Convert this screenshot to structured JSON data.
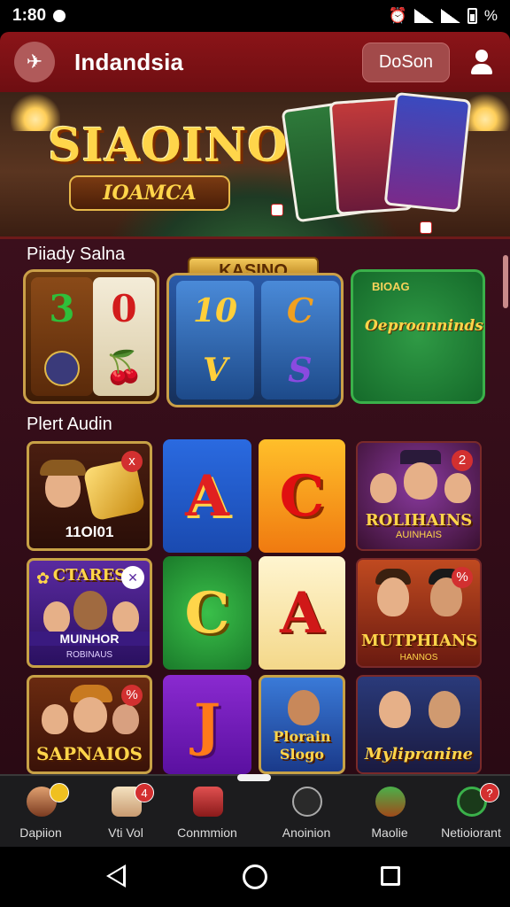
{
  "status_bar": {
    "time": "1:80",
    "battery_text": "%"
  },
  "header": {
    "brand": "Indandsia",
    "deposit_label": "DoSon"
  },
  "banner": {
    "title": "SIAOINO",
    "subtitle": "IOAMCA"
  },
  "sections": {
    "first_label": "Piiady Salna",
    "second_label": "Plert Audin"
  },
  "slot_row": {
    "tile1_symbols": [
      "3",
      "0",
      "🍒"
    ],
    "tile2_tag": "KASINO",
    "tile2_symbols": [
      "10",
      "C",
      "V",
      "S"
    ],
    "tile3_title": "BIOAG",
    "tile3_body": "Oeproanninds"
  },
  "games": [
    {
      "title": "11Ol01",
      "badge": "x"
    },
    {
      "letter": "A"
    },
    {
      "letter": "C"
    },
    {
      "title": "ROLIHAINS",
      "sub": "AUINHAIS",
      "badge": "2"
    },
    {
      "title": "CTARES",
      "sub": "MUINHOR",
      "foot": "ROBINAUS"
    },
    {
      "letter": "C"
    },
    {
      "letter": "A"
    },
    {
      "title": "MUTPHIANS",
      "sub": "HANNOS",
      "badge": "%"
    },
    {
      "title": "SAPNAIOS",
      "badge": "%"
    },
    {
      "letter": "J"
    },
    {
      "title": "Plorain",
      "sub": "Slogo"
    },
    {
      "title": "Mylipranine"
    }
  ],
  "bottom_nav": [
    {
      "label": "Dapiion",
      "icon": "person-icon",
      "badge": ""
    },
    {
      "label": "Vti Vol",
      "icon": "dice-icon",
      "badge": "4"
    },
    {
      "label": "Conmmion",
      "icon": "chips-icon",
      "badge": ""
    },
    {
      "label": "Anoinion",
      "icon": "clock-icon",
      "badge": ""
    },
    {
      "label": "Maolie",
      "icon": "dealer-icon",
      "badge": ""
    },
    {
      "label": "Netioiorant",
      "icon": "refresh-icon",
      "badge": "?"
    }
  ],
  "colors": {
    "accent": "#8b1418",
    "gold": "#ffd54a",
    "background": "#2a0a14"
  }
}
